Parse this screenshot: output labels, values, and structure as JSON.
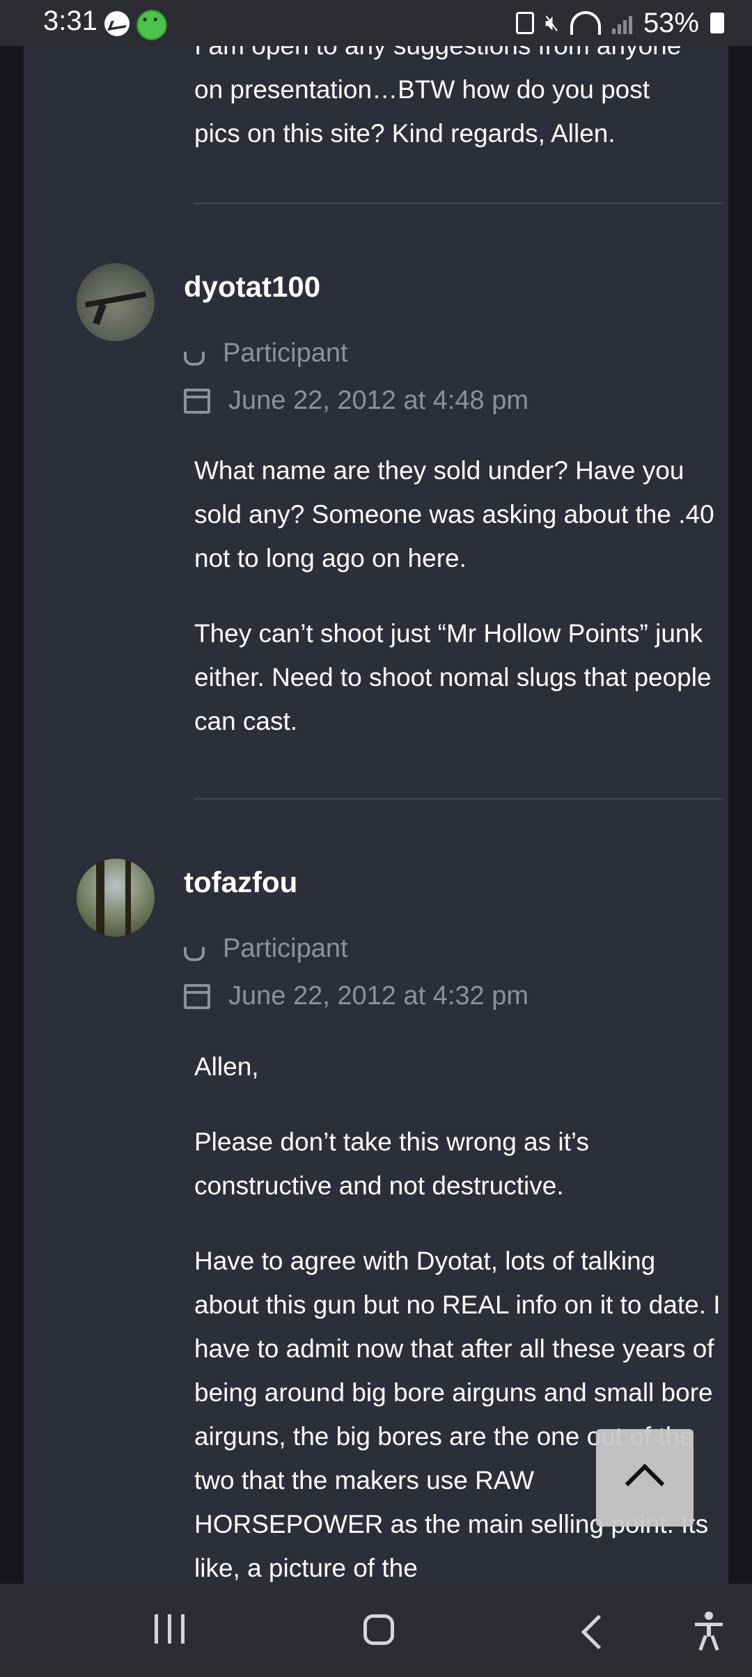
{
  "status_bar": {
    "time": "3:31",
    "battery": "53%",
    "icons": [
      "messenger-icon",
      "app-face-icon",
      "battery-saver-icon",
      "mute-icon",
      "wifi-icon",
      "signal-icon",
      "battery-icon"
    ]
  },
  "top_post": {
    "partial_line": "I am open to any suggestions from anyone",
    "lines": [
      "on presentation…BTW how do you post",
      "pics on this site? Kind regards, Allen."
    ]
  },
  "replies": [
    {
      "author": "dyotat100",
      "role": "Participant",
      "date": "June 22, 2012 at 4:48 pm",
      "paragraphs": [
        "What name are they sold under? Have you sold any? Someone was asking about the .40 not to long ago on here.",
        "They can’t shoot just “Mr Hollow Points” junk either. Need to shoot nomal slugs that people can cast."
      ]
    },
    {
      "author": "tofazfou",
      "role": "Participant",
      "date": "June 22, 2012 at 4:32 pm",
      "paragraphs": [
        "Allen,",
        "Please don’t take this wrong as it’s constructive and not destructive.",
        "Have to agree with Dyotat, lots of talking about this gun but no REAL info on it to date. I have to admit now that after all these years of being around big bore airguns and small bore airguns, the big bores are the one out of the two that the makers use RAW HORSEPOWER as the main selling point. Its like, a picture of the"
      ]
    }
  ],
  "colors": {
    "card_bg": "#2c2f3a",
    "page_bg": "#16171c",
    "meta_text": "#8e919b",
    "bars": "#2c2d33"
  }
}
